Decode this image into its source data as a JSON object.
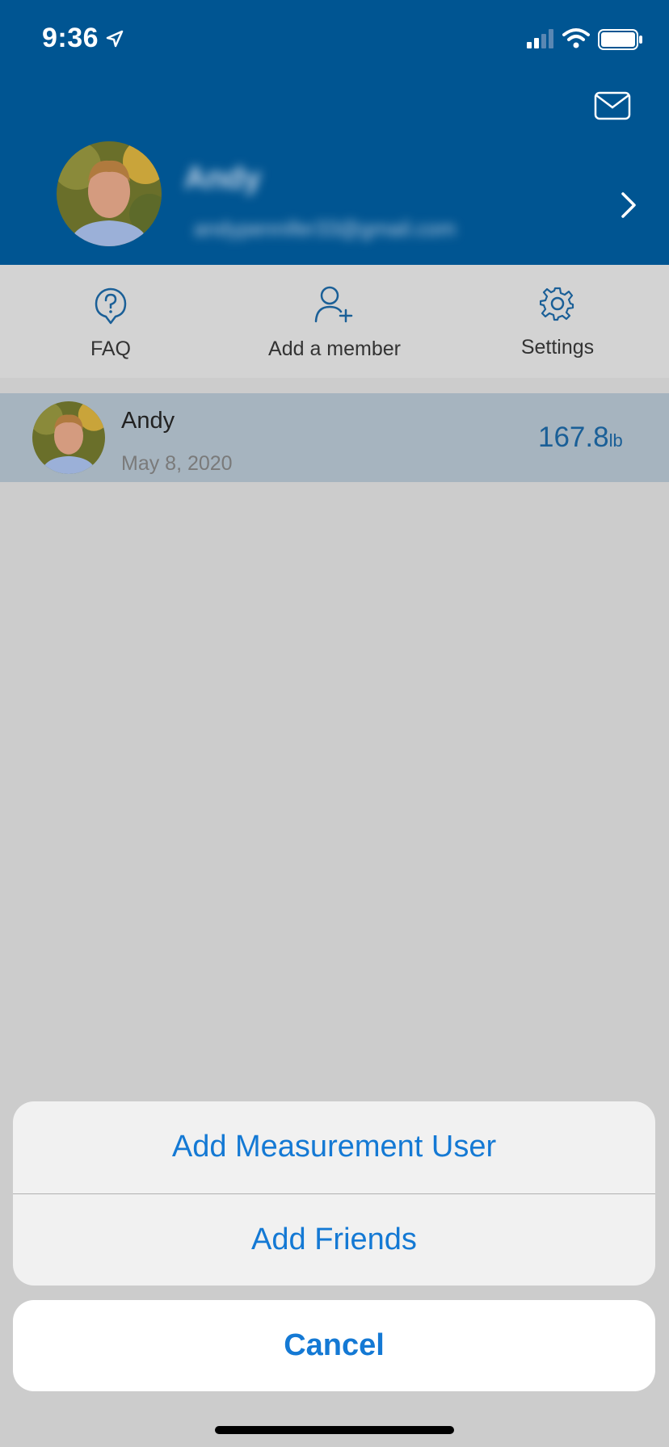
{
  "status_bar": {
    "time": "9:36"
  },
  "header": {
    "name": "Andy",
    "email": "andypennifer33@gmail.com"
  },
  "actions": [
    {
      "label": "FAQ",
      "icon": "question-icon"
    },
    {
      "label": "Add a member",
      "icon": "add-member-icon"
    },
    {
      "label": "Settings",
      "icon": "gear-icon"
    }
  ],
  "member_row": {
    "name": "Andy",
    "date": "May 8, 2020",
    "weight_value": "167.8",
    "weight_unit": "lb"
  },
  "action_sheet": {
    "options": [
      "Add Measurement User",
      "Add Friends"
    ],
    "cancel_label": "Cancel"
  },
  "colors": {
    "header_bg": "#005592",
    "accent": "#1479d4",
    "row_highlight": "#a6b4bf"
  }
}
